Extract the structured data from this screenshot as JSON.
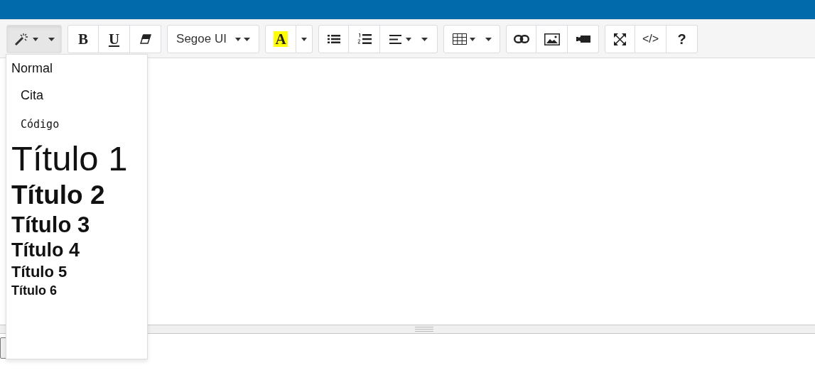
{
  "toolbar": {
    "groups": [
      {
        "buttons": [
          {
            "kind": "style",
            "selected": true
          }
        ]
      },
      {
        "buttons": [
          {
            "kind": "bold",
            "label": "B"
          },
          {
            "kind": "underline",
            "label": "U"
          },
          {
            "kind": "eraser"
          }
        ]
      },
      {
        "buttons": [
          {
            "kind": "font",
            "label": "Segoe UI"
          }
        ]
      },
      {
        "buttons": [
          {
            "kind": "forecolor",
            "label": "A",
            "color": "#ffff00"
          },
          {
            "kind": "colormenu"
          }
        ]
      },
      {
        "buttons": [
          {
            "kind": "bullets"
          },
          {
            "kind": "numbers"
          },
          {
            "kind": "align"
          }
        ]
      },
      {
        "buttons": [
          {
            "kind": "table"
          }
        ]
      },
      {
        "buttons": [
          {
            "kind": "link"
          },
          {
            "kind": "image"
          },
          {
            "kind": "video"
          }
        ]
      },
      {
        "buttons": [
          {
            "kind": "fullscreen"
          },
          {
            "kind": "code",
            "label": "</>"
          },
          {
            "kind": "help",
            "label": "?"
          }
        ]
      }
    ]
  },
  "style_menu": [
    {
      "kind": "p",
      "label": "Normal"
    },
    {
      "kind": "blockquote",
      "label": "Cita"
    },
    {
      "kind": "pre",
      "label": "Código"
    },
    {
      "kind": "h1",
      "label": "Título 1"
    },
    {
      "kind": "h2",
      "label": "Título 2"
    },
    {
      "kind": "h3",
      "label": "Título 3"
    },
    {
      "kind": "h4",
      "label": "Título 4"
    },
    {
      "kind": "h5",
      "label": "Título 5"
    },
    {
      "kind": "h6",
      "label": "Título 6"
    }
  ]
}
